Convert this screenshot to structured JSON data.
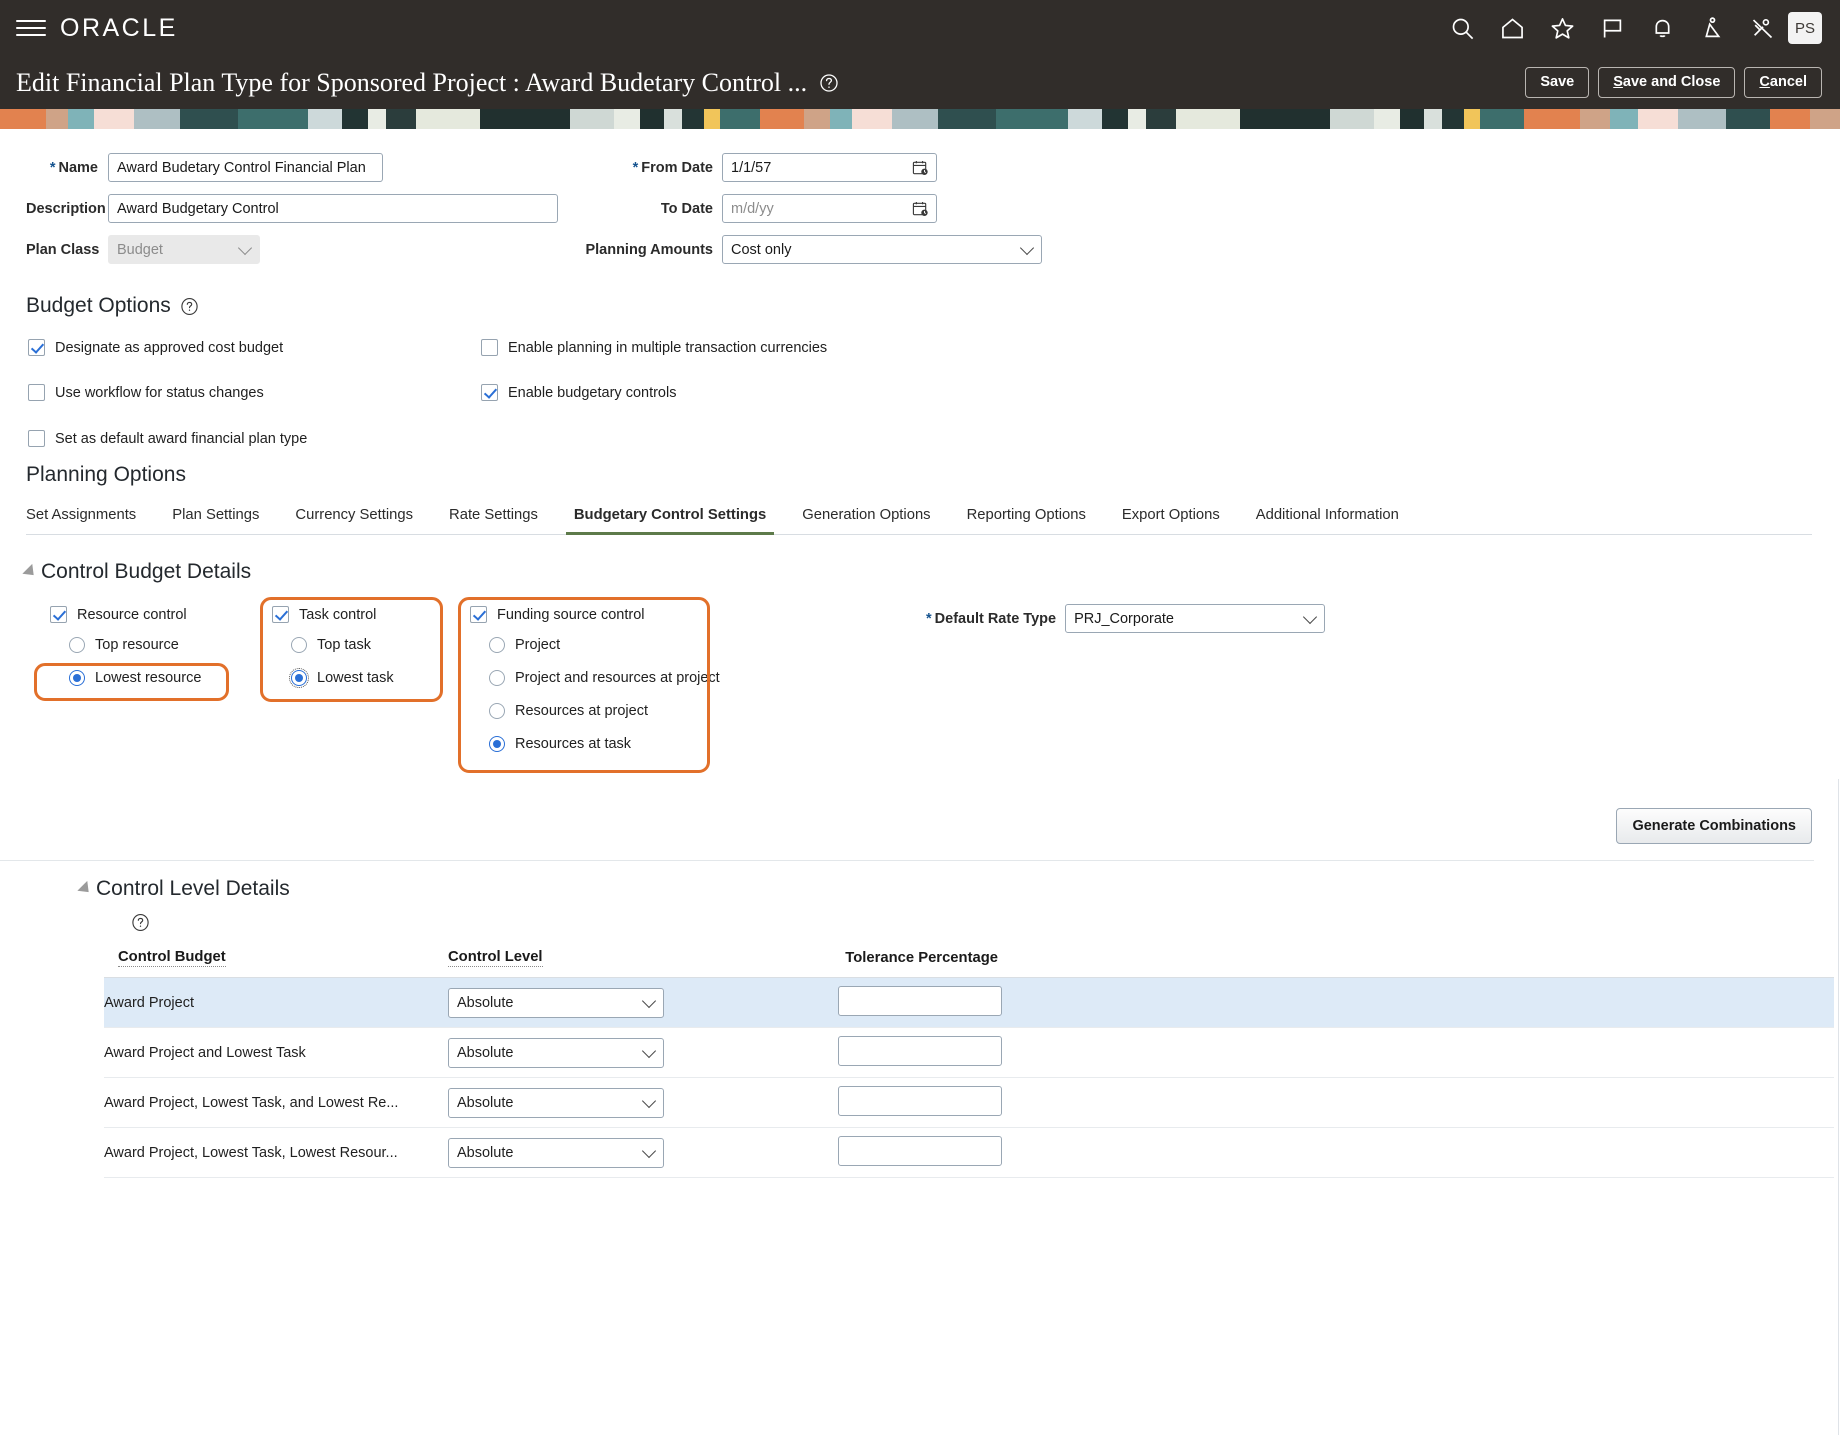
{
  "header": {
    "logo_text": "ORACLE",
    "menu_icon": "hamburger-icon",
    "icons": [
      {
        "name": "search-icon",
        "label": "Search"
      },
      {
        "name": "home-icon",
        "label": "Home"
      },
      {
        "name": "favorites-star-icon",
        "label": "Favorites"
      },
      {
        "name": "flag-icon",
        "label": "Flagged"
      },
      {
        "name": "notifications-bell-icon",
        "label": "Notifications"
      },
      {
        "name": "accessibility-icon",
        "label": "Accessibility"
      },
      {
        "name": "settings-slash-icon",
        "label": "Settings"
      }
    ],
    "avatar_initials": "PS"
  },
  "title_bar": {
    "title": "Edit Financial Plan Type for Sponsored Project : Award Budetary Control ...",
    "help_icon": "help-icon",
    "buttons": [
      {
        "name": "save-button",
        "label": "Save",
        "accesskey": ""
      },
      {
        "name": "save-and-close-button",
        "label": "Save and Close",
        "accesskey": "S"
      },
      {
        "name": "cancel-button",
        "label": "Cancel",
        "accesskey": "C"
      }
    ]
  },
  "form": {
    "name_label": "Name",
    "name_value": "Award Budetary Control Financial Plan",
    "description_label": "Description",
    "description_value": "Award Budgetary Control",
    "plan_class_label": "Plan Class",
    "plan_class_value": "Budget",
    "from_date_label": "From Date",
    "from_date_value": "1/1/57",
    "to_date_label": "To Date",
    "to_date_placeholder": "m/d/yy",
    "planning_amounts_label": "Planning Amounts",
    "planning_amounts_value": "Cost only"
  },
  "budget_options": {
    "heading": "Budget Options",
    "checkboxes": [
      {
        "label": "Designate as approved cost budget",
        "checked": true,
        "name": "checkbox-designate-approved-cost-budget"
      },
      {
        "label": "Use workflow for status changes",
        "checked": false,
        "name": "checkbox-use-workflow-status-changes"
      },
      {
        "label": "Set as default award financial plan type",
        "checked": false,
        "name": "checkbox-set-default-award-plan-type"
      },
      {
        "label": "Enable planning in multiple transaction currencies",
        "checked": false,
        "name": "checkbox-enable-multi-currency-planning"
      },
      {
        "label": "Enable budgetary controls",
        "checked": true,
        "name": "checkbox-enable-budgetary-controls"
      }
    ]
  },
  "planning_options": {
    "heading": "Planning Options",
    "tabs": [
      {
        "label": "Set Assignments",
        "active": false
      },
      {
        "label": "Plan Settings",
        "active": false
      },
      {
        "label": "Currency Settings",
        "active": false
      },
      {
        "label": "Rate Settings",
        "active": false
      },
      {
        "label": "Budgetary Control Settings",
        "active": true
      },
      {
        "label": "Generation Options",
        "active": false
      },
      {
        "label": "Reporting Options",
        "active": false
      },
      {
        "label": "Export Options",
        "active": false
      },
      {
        "label": "Additional Information",
        "active": false
      }
    ],
    "active_tab_underline_color": "#5d7a4a"
  },
  "control_budget_details": {
    "heading": "Control Budget Details",
    "resource_control": {
      "checkbox_label": "Resource control",
      "checked": true,
      "options": [
        {
          "label": "Top resource",
          "selected": false
        },
        {
          "label": "Lowest resource",
          "selected": true
        }
      ]
    },
    "task_control": {
      "checkbox_label": "Task control",
      "checked": true,
      "options": [
        {
          "label": "Top task",
          "selected": false
        },
        {
          "label": "Lowest task",
          "selected": true
        }
      ]
    },
    "funding_source_control": {
      "checkbox_label": "Funding source control",
      "checked": true,
      "options": [
        {
          "label": "Project",
          "selected": false
        },
        {
          "label": "Project and resources at project",
          "selected": false
        },
        {
          "label": "Resources at project",
          "selected": false
        },
        {
          "label": "Resources at task",
          "selected": true
        }
      ]
    },
    "default_rate_type_label": "Default Rate Type",
    "default_rate_type_value": "PRJ_Corporate",
    "generate_combinations_label": "Generate Combinations",
    "highlight_color": "#e2702a"
  },
  "control_level_details": {
    "heading": "Control Level Details",
    "help_icon": "help-icon",
    "columns": [
      "Control Budget",
      "Control Level",
      "Tolerance Percentage"
    ],
    "rows": [
      {
        "control_budget": "Award Project",
        "control_level": "Absolute",
        "tolerance": "",
        "selected": true
      },
      {
        "control_budget": "Award Project and Lowest Task",
        "control_level": "Absolute",
        "tolerance": "",
        "selected": false
      },
      {
        "control_budget": "Award Project, Lowest Task, and Lowest Re...",
        "control_level": "Absolute",
        "tolerance": "",
        "selected": false
      },
      {
        "control_budget": "Award Project, Lowest Task, Lowest Resour...",
        "control_level": "Absolute",
        "tolerance": "",
        "selected": false
      }
    ]
  }
}
